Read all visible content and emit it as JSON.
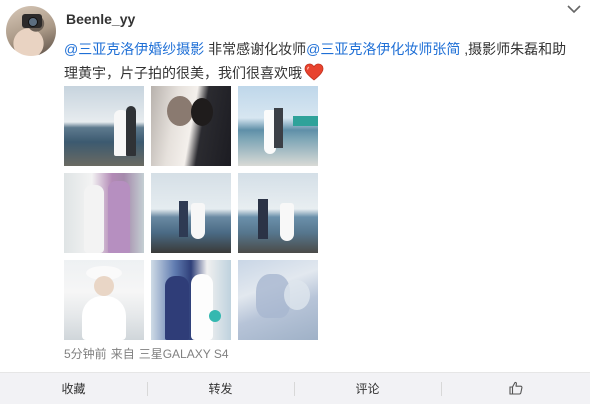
{
  "post": {
    "username": "Beenle_yy",
    "text": {
      "mention1": "@三亚克洛伊婚纱摄影",
      "part1": " 非常感谢化妆师",
      "mention2": "@三亚克洛伊化妆师张简",
      "part2": " ,摄影师朱磊和助理黄宇，片子拍的很美，我们很喜欢哦"
    },
    "meta": {
      "time": "5分钟前",
      "from_label": "来自",
      "device": "三星GALAXY S4"
    },
    "photos": [
      "photo-1",
      "photo-2",
      "photo-3",
      "photo-4",
      "photo-5",
      "photo-6",
      "photo-7",
      "photo-8",
      "photo-9"
    ]
  },
  "actions": {
    "favorite": "收藏",
    "repost": "转发",
    "comment": "评论",
    "like_icon": "thumbs-up-icon"
  },
  "colors": {
    "link": "#1e6fd6",
    "meta": "#808080",
    "actionbar_bg": "#f2f2f5",
    "heart": "#e8432e"
  }
}
